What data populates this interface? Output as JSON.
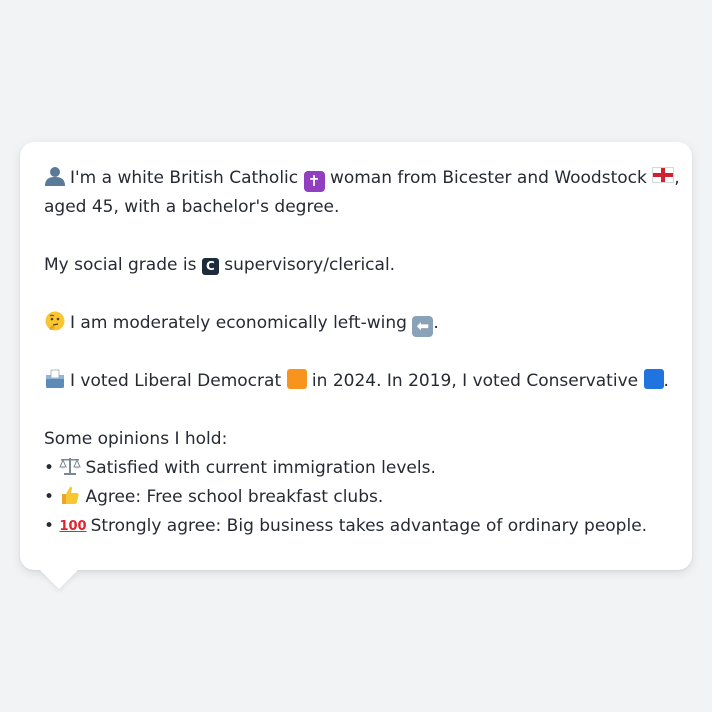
{
  "persona": {
    "intro_text": "I'm a white British Catholic",
    "intro_text2": "woman from Bicester and Woodstock",
    "intro_line2": "aged 45, with a bachelor's degree.",
    "social_grade_prefix": "My social grade is",
    "social_grade_badge": "C",
    "social_grade_suffix": "supervisory/clerical.",
    "economic_text": "I am moderately economically left-wing",
    "vote_text_1": "I voted Liberal Democrat",
    "vote_text_2": "in 2024. In 2019, I voted Conservative",
    "opinions_heading": "Some opinions I hold:",
    "opinions": [
      {
        "bullet": "•",
        "text": "Satisfied with current immigration levels."
      },
      {
        "bullet": "•",
        "text": "Agree: Free school breakfast clubs."
      },
      {
        "bullet": "•",
        "text": "Strongly agree: Big business takes advantage of ordinary people."
      }
    ],
    "hundred_label": "100"
  },
  "icons": {
    "person": "person-silhouette-icon",
    "cross": "latin-cross-icon",
    "flag": "england-flag-icon",
    "thinking": "thinking-face-icon",
    "left_arrow": "left-arrow-icon",
    "ballot": "ballot-box-icon",
    "libdem_square": "orange-square-icon",
    "con_square": "blue-square-icon",
    "scales": "balance-scale-icon",
    "thumbs": "thumbs-up-icon",
    "hundred": "hundred-points-icon"
  },
  "colors": {
    "libdem": "#f7941d",
    "conservative": "#1f74e0"
  }
}
